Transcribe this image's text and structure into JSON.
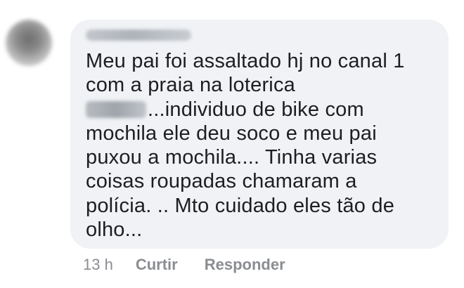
{
  "comment": {
    "text_lines": [
      "Meu pai foi assaltado hj no canal 1",
      "com a praia na loterica",
      "...individuo de bike com",
      "mochila ele deu soco e meu pai",
      "puxou a mochila.... Tinha varias",
      "coisas roupadas chamaram a",
      "polícia. .. Mto cuidado eles tão de",
      "olho..."
    ]
  },
  "actions": {
    "timestamp": "13 h",
    "like_label": "Curtir",
    "reply_label": "Responder"
  },
  "colors": {
    "bubble_background": "#f0f2f5",
    "text": "#1c1e21",
    "meta_text": "#8a8d91"
  }
}
